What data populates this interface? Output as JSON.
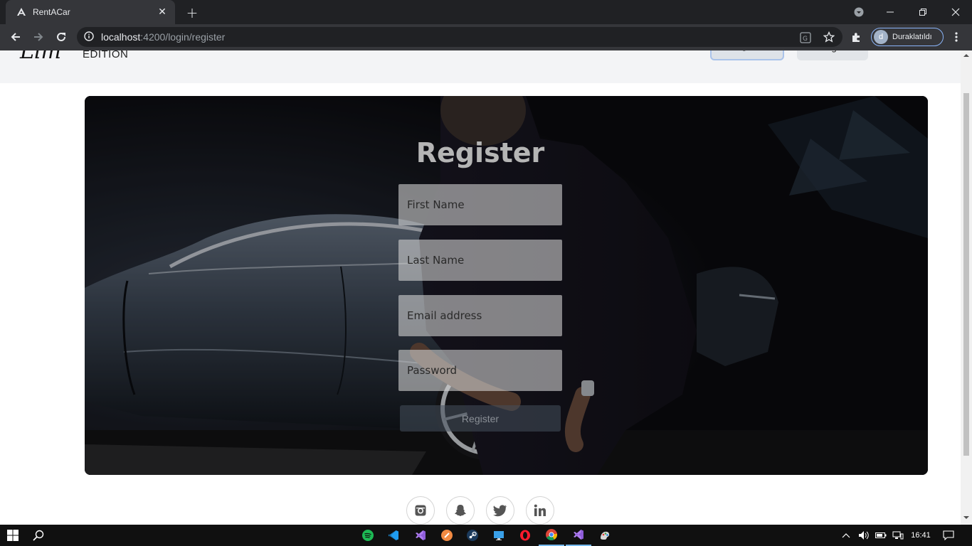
{
  "browser": {
    "tab_title": "RentACar",
    "new_tab_label": "+",
    "url_host": "localhost",
    "url_path": ":4200/login/register",
    "profile_initial": "d",
    "profile_status": "Duraklatıldı"
  },
  "site": {
    "logo_script": "Lim",
    "logo_text": "EDITION",
    "nav": {
      "register_label": "Register",
      "login_label": "Login"
    }
  },
  "form": {
    "title": "Register",
    "first_name_placeholder": "First Name",
    "last_name_placeholder": "Last Name",
    "email_placeholder": "Email address",
    "password_placeholder": "Password",
    "submit_label": "Register"
  },
  "footer": {
    "social_icons": [
      "instagram-icon",
      "snapchat-icon",
      "twitter-icon",
      "linkedin-icon"
    ]
  },
  "taskbar": {
    "clock": "16:41",
    "apps": [
      "spotify",
      "vscode",
      "visual-studio",
      "browser-orange",
      "steam",
      "remote-desktop",
      "opera",
      "chrome",
      "visual-studio-2",
      "paint"
    ]
  },
  "colors": {
    "accent": "#8ab4f8",
    "browser_dark": "#202124",
    "browser_toolbar": "#35363a"
  }
}
